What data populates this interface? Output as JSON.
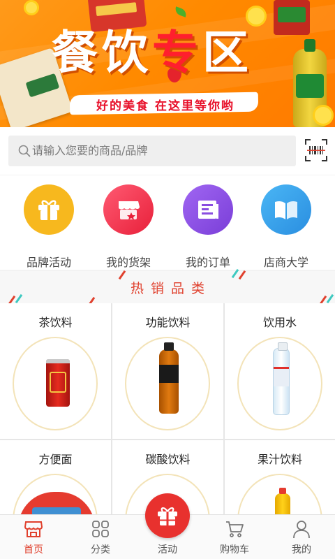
{
  "banner": {
    "title_part1": "餐饮",
    "title_part2": "专",
    "title_part3": "区",
    "subtitle": "好的美食 在这里等你哟"
  },
  "search": {
    "placeholder": "请输入您要的商品/品牌"
  },
  "quick_menu": [
    {
      "label": "品牌活动",
      "icon": "gift-icon",
      "color": "#f7b81e"
    },
    {
      "label": "我的货架",
      "icon": "store-shelf-icon",
      "color": "#f0404f"
    },
    {
      "label": "我的订单",
      "icon": "order-list-icon",
      "color": "#8a4ee0"
    },
    {
      "label": "店商大学",
      "icon": "book-icon",
      "color": "#3aa0ea"
    }
  ],
  "hot": {
    "title": "热销品类"
  },
  "categories": [
    {
      "label": "茶饮料",
      "product": "tea-can"
    },
    {
      "label": "功能饮料",
      "product": "energy-drink-bottle"
    },
    {
      "label": "饮用水",
      "product": "water-bottle"
    },
    {
      "label": "方便面",
      "product": "instant-noodle-bowl"
    },
    {
      "label": "碳酸饮料",
      "product": "soda"
    },
    {
      "label": "果汁饮料",
      "product": "juice-bottle"
    }
  ],
  "tabbar": {
    "tabs": [
      {
        "label": "首页",
        "icon": "home-store-icon",
        "active": true
      },
      {
        "label": "分类",
        "icon": "grid-icon",
        "active": false
      },
      {
        "label": "活动",
        "icon": "gift-icon",
        "active": false
      },
      {
        "label": "购物车",
        "icon": "cart-icon",
        "active": false
      },
      {
        "label": "我的",
        "icon": "user-icon",
        "active": false
      }
    ]
  },
  "colors": {
    "accent": "#e0412e",
    "banner": "#ff8a00"
  }
}
